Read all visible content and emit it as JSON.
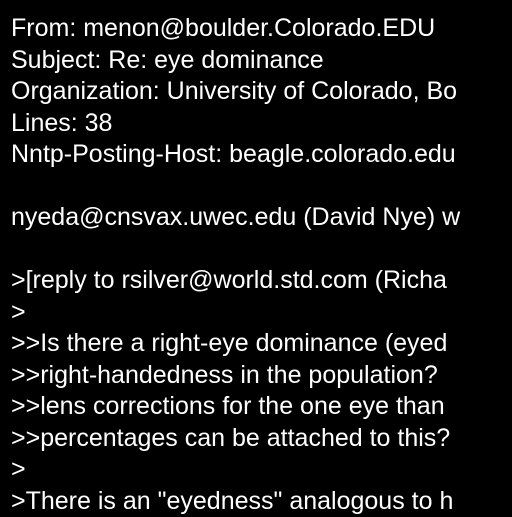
{
  "colors": {
    "background": "#000000",
    "text": "#ffffff"
  },
  "lines": [
    "From: menon@boulder.Colorado.EDU",
    "Subject: Re: eye dominance",
    "Organization: University of Colorado, Bo",
    "Lines: 38",
    "Nntp-Posting-Host: beagle.colorado.edu",
    "",
    "nyeda@cnsvax.uwec.edu (David Nye) w",
    "",
    ">[reply to rsilver@world.std.com (Richa",
    ">",
    ">>Is there a right-eye dominance (eyed",
    ">>right-handedness in the population? ",
    ">>lens corrections for the one eye than",
    ">>percentages can be attached to this?",
    ">",
    ">There is an \"eyedness\" analogous to h"
  ]
}
